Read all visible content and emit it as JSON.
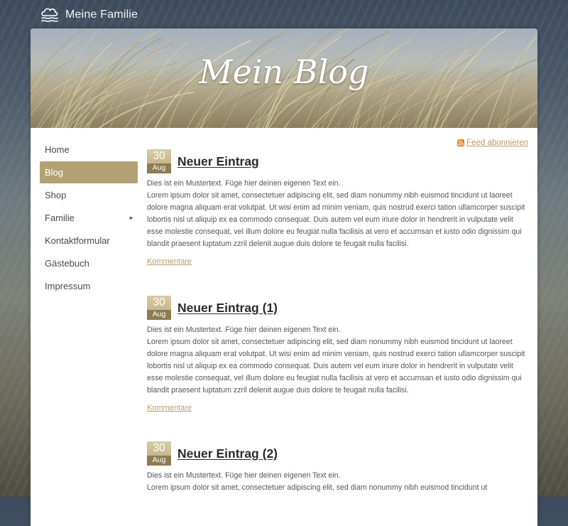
{
  "site": {
    "name": "Meine Familie",
    "logo_icon": "cloud-waves-icon"
  },
  "banner": {
    "title": "Mein Blog"
  },
  "sidebar": {
    "items": [
      {
        "label": "Home",
        "active": false
      },
      {
        "label": "Blog",
        "active": true
      },
      {
        "label": "Shop",
        "active": false
      },
      {
        "label": "Familie",
        "active": false,
        "has_submenu": true,
        "submenu_icon": "triangle-right-icon"
      },
      {
        "label": "Kontaktformular",
        "active": false
      },
      {
        "label": "Gästebuch",
        "active": false
      },
      {
        "label": "Impressum",
        "active": false
      }
    ]
  },
  "feed": {
    "label": "Feed abonnieren",
    "icon": "rss-icon"
  },
  "entries": [
    {
      "day": "30",
      "month": "Aug",
      "title": "Neuer Eintrag",
      "intro": "Dies ist ein Mustertext. Füge hier deinen eigenen Text ein.",
      "text": "Lorem ipsum dolor sit amet, consectetuer adipiscing elit, sed diam nonummy nibh euismod tincidunt ut laoreet dolore magna aliquam erat volutpat. Ut wisi enim ad minim veniam, quis nostrud exerci tation ullamcorper suscipit lobortis nisl ut aliquip ex ea commodo consequat. Duis autem vel eum iriure dolor in hendrerit in vulputate velit esse molestie consequat, vel illum dolore eu feugiat nulla facilisis at vero et accumsan et iusto odio dignissim qui blandit praesent luptatum zzril delenit augue duis dolore te feugait nulla facilisi.",
      "comments_label": "Kommentare"
    },
    {
      "day": "30",
      "month": "Aug",
      "title": "Neuer Eintrag (1)",
      "intro": "Dies ist ein Mustertext. Füge hier deinen eigenen Text ein.",
      "text": "Lorem ipsum dolor sit amet, consectetuer adipiscing elit, sed diam nonummy nibh euismod tincidunt ut laoreet dolore magna aliquam erat volutpat. Ut wisi enim ad minim veniam, quis nostrud exerci tation ullamcorper suscipit lobortis nisl ut aliquip ex ea commodo consequat. Duis autem vel eum iriure dolor in hendrerit in vulputate velit esse molestie consequat, vel illum dolore eu feugiat nulla facilisis at vero et accumsan et iusto odio dignissim qui blandit praesent luptatum zzril delenit augue duis dolore te feugait nulla facilisi.",
      "comments_label": "Kommentare"
    },
    {
      "day": "30",
      "month": "Aug",
      "title": "Neuer Eintrag (2)",
      "intro": "Dies ist ein Mustertext. Füge hier deinen eigenen Text ein.",
      "text": "Lorem ipsum dolor sit amet, consectetuer adipiscing elit, sed diam nonummy nibh euismod tincidunt ut",
      "comments_label": ""
    }
  ],
  "colors": {
    "accent": "#b3a173",
    "link": "#b59d6a",
    "rss": "#e87d1e"
  }
}
